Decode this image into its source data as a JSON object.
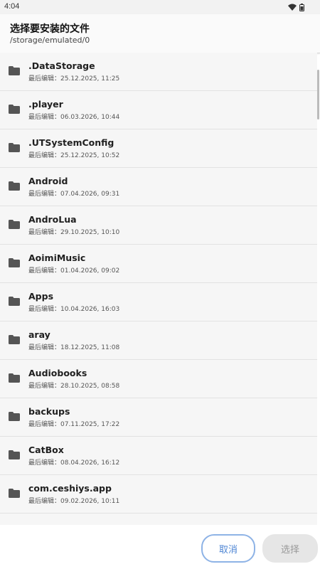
{
  "status": {
    "time": "4:04"
  },
  "header": {
    "title": "选择要安装的文件",
    "path": "/storage/emulated/0"
  },
  "items": [
    {
      "name": ".DataStorage",
      "meta": "最后编辑：25.12.2025, 11:25"
    },
    {
      "name": ".player",
      "meta": "最后编辑：06.03.2026, 10:44"
    },
    {
      "name": ".UTSystemConfig",
      "meta": "最后编辑：25.12.2025, 10:52"
    },
    {
      "name": "Android",
      "meta": "最后编辑：07.04.2026, 09:31"
    },
    {
      "name": "AndroLua",
      "meta": "最后编辑：29.10.2025, 10:10"
    },
    {
      "name": "AoimiMusic",
      "meta": "最后编辑：01.04.2026, 09:02"
    },
    {
      "name": "Apps",
      "meta": "最后编辑：10.04.2026, 16:03"
    },
    {
      "name": "aray",
      "meta": "最后编辑：18.12.2025, 11:08"
    },
    {
      "name": "Audiobooks",
      "meta": "最后编辑：28.10.2025, 08:58"
    },
    {
      "name": "backups",
      "meta": "最后编辑：07.11.2025, 17:22"
    },
    {
      "name": "CatBox",
      "meta": "最后编辑：08.04.2026, 16:12"
    },
    {
      "name": "com.ceshiys.app",
      "meta": "最后编辑：09.02.2026, 10:11"
    },
    {
      "name": "",
      "meta": ""
    }
  ],
  "buttons": {
    "cancel": "取消",
    "select": "选择"
  }
}
